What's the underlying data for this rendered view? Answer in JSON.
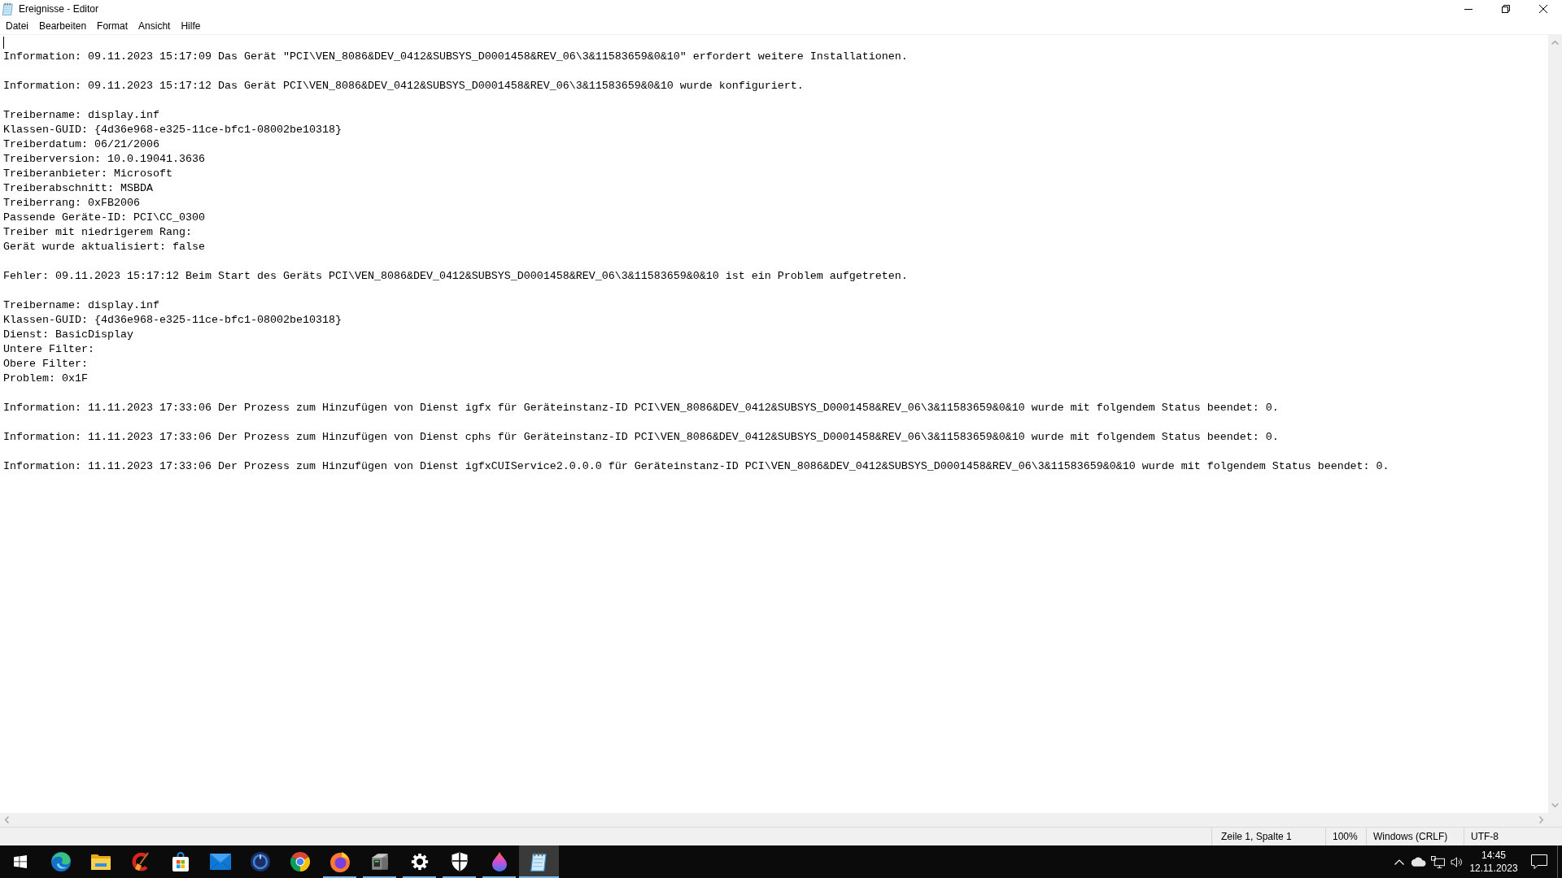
{
  "window": {
    "title": "Ereignisse - Editor"
  },
  "menu_bar": [
    "Datei",
    "Bearbeiten",
    "Format",
    "Ansicht",
    "Hilfe"
  ],
  "editor": {
    "paragraphs": [
      [
        "Information: 09.11.2023 15:17:09 Das Gerät \"PCI\\VEN_8086&DEV_0412&SUBSYS_D0001458&REV_06\\3&11583659&0&10\" erfordert weitere Installationen."
      ],
      [
        "Information: 09.11.2023 15:17:12 Das Gerät PCI\\VEN_8086&DEV_0412&SUBSYS_D0001458&REV_06\\3&11583659&0&10 wurde konfiguriert."
      ],
      [
        "Treibername: display.inf",
        "Klassen-GUID: {4d36e968-e325-11ce-bfc1-08002be10318}",
        "Treiberdatum: 06/21/2006",
        "Treiberversion: 10.0.19041.3636",
        "Treiberanbieter: Microsoft",
        "Treiberabschnitt: MSBDA",
        "Treiberrang: 0xFB2006",
        "Passende Geräte-ID: PCI\\CC_0300",
        "Treiber mit niedrigerem Rang:",
        "Gerät wurde aktualisiert: false"
      ],
      [
        "Fehler: 09.11.2023 15:17:12 Beim Start des Geräts PCI\\VEN_8086&DEV_0412&SUBSYS_D0001458&REV_06\\3&11583659&0&10 ist ein Problem aufgetreten."
      ],
      [
        "Treibername: display.inf",
        "Klassen-GUID: {4d36e968-e325-11ce-bfc1-08002be10318}",
        "Dienst: BasicDisplay",
        "Untere Filter:",
        "Obere Filter:",
        "Problem: 0x1F"
      ],
      [
        "Information: 11.11.2023 17:33:06 Der Prozess zum Hinzufügen von Dienst igfx für Geräteinstanz-ID PCI\\VEN_8086&DEV_0412&SUBSYS_D0001458&REV_06\\3&11583659&0&10 wurde mit folgendem Status beendet: 0."
      ],
      [
        "Information: 11.11.2023 17:33:06 Der Prozess zum Hinzufügen von Dienst cphs für Geräteinstanz-ID PCI\\VEN_8086&DEV_0412&SUBSYS_D0001458&REV_06\\3&11583659&0&10 wurde mit folgendem Status beendet: 0."
      ],
      [
        "Information: 11.11.2023 17:33:06 Der Prozess zum Hinzufügen von Dienst igfxCUIService2.0.0.0 für Geräteinstanz-ID PCI\\VEN_8086&DEV_0412&SUBSYS_D0001458&REV_06\\3&11583659&0&10 wurde mit folgendem Status beendet: 0."
      ]
    ]
  },
  "status_bar": {
    "cursor_position": "Zeile 1, Spalte 1",
    "zoom": "100%",
    "line_ending": "Windows (CRLF)",
    "encoding": "UTF-8"
  },
  "taskbar": {
    "apps": [
      {
        "running": false,
        "selected": false
      },
      {
        "running": false,
        "selected": false
      },
      {
        "running": false,
        "selected": false
      },
      {
        "running": false,
        "selected": false
      },
      {
        "running": false,
        "selected": false
      },
      {
        "running": false,
        "selected": false
      },
      {
        "running": false,
        "selected": false
      },
      {
        "running": true,
        "selected": false
      },
      {
        "running": true,
        "selected": false
      },
      {
        "running": true,
        "selected": false
      },
      {
        "running": true,
        "selected": false
      },
      {
        "running": true,
        "selected": false
      },
      {
        "running": true,
        "selected": true
      }
    ],
    "clock": {
      "time": "14:45",
      "date": "12.11.2023"
    }
  }
}
